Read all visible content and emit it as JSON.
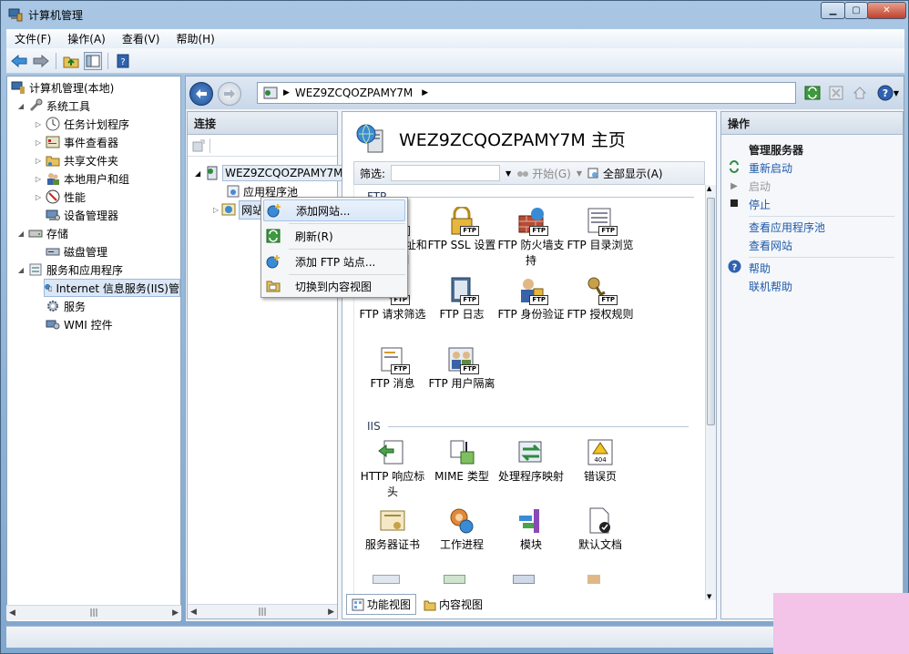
{
  "window": {
    "title": "计算机管理"
  },
  "menu": [
    "文件(F)",
    "操作(A)",
    "查看(V)",
    "帮助(H)"
  ],
  "tree": {
    "root": "计算机管理(本地)",
    "system_tools": "系统工具",
    "task_scheduler": "任务计划程序",
    "event_viewer": "事件查看器",
    "shared_folders": "共享文件夹",
    "local_users": "本地用户和组",
    "performance": "性能",
    "device_manager": "设备管理器",
    "storage": "存储",
    "disk_management": "磁盘管理",
    "services_apps": "服务和应用程序",
    "iis": "Internet 信息服务(IIS)管",
    "services": "服务",
    "wmi": "WMI 控件"
  },
  "address": {
    "path": "WEZ9ZCQOZPAMY7M"
  },
  "connections": {
    "header": "连接",
    "server": "WEZ9ZCQOZPAMY7M",
    "app_pools": "应用程序池",
    "sites": "网站"
  },
  "home": {
    "title": "WEZ9ZCQOZPAMY7M 主页",
    "filter_label": "筛选:",
    "start_label": "开始(G)",
    "show_all_label": "全部显示(A)",
    "group_ftp": "FTP",
    "group_iis": "IIS",
    "ftp_features": [
      {
        "label": "FTP IP 地址和域限制",
        "icon": "ftp-ip-restrictions-icon"
      },
      {
        "label": "FTP SSL 设置",
        "icon": "ftp-ssl-icon"
      },
      {
        "label": "FTP 防火墙支持",
        "icon": "ftp-firewall-icon"
      },
      {
        "label": "FTP 目录浏览",
        "icon": "ftp-directory-browsing-icon"
      },
      {
        "label": "FTP 请求筛选",
        "icon": "ftp-request-filtering-icon"
      },
      {
        "label": "FTP 日志",
        "icon": "ftp-logging-icon"
      },
      {
        "label": "FTP 身份验证",
        "icon": "ftp-authentication-icon"
      },
      {
        "label": "FTP 授权规则",
        "icon": "ftp-authorization-icon"
      },
      {
        "label": "FTP 消息",
        "icon": "ftp-messages-icon"
      },
      {
        "label": "FTP 用户隔离",
        "icon": "ftp-user-isolation-icon"
      }
    ],
    "iis_features": [
      {
        "label": "HTTP 响应标头",
        "icon": "http-headers-icon"
      },
      {
        "label": "MIME 类型",
        "icon": "mime-types-icon"
      },
      {
        "label": "处理程序映射",
        "icon": "handler-mappings-icon"
      },
      {
        "label": "错误页",
        "icon": "error-pages-icon"
      },
      {
        "label": "服务器证书",
        "icon": "server-certificates-icon"
      },
      {
        "label": "工作进程",
        "icon": "worker-processes-icon"
      },
      {
        "label": "模块",
        "icon": "modules-icon"
      },
      {
        "label": "默认文档",
        "icon": "default-document-icon"
      }
    ],
    "features_view": "功能视图",
    "content_view": "内容视图"
  },
  "actions": {
    "header": "操作",
    "manage_server": "管理服务器",
    "restart": "重新启动",
    "start": "启动",
    "stop": "停止",
    "view_app_pools": "查看应用程序池",
    "view_sites": "查看网站",
    "help": "帮助",
    "online_help": "联机帮助"
  },
  "context_menu": {
    "add_site": "添加网站...",
    "refresh": "刷新(R)",
    "add_ftp": "添加 FTP 站点...",
    "switch_content": "切换到内容视图"
  },
  "colors": {
    "accent": "#1e5aa8",
    "window": "#a9c7e4"
  }
}
